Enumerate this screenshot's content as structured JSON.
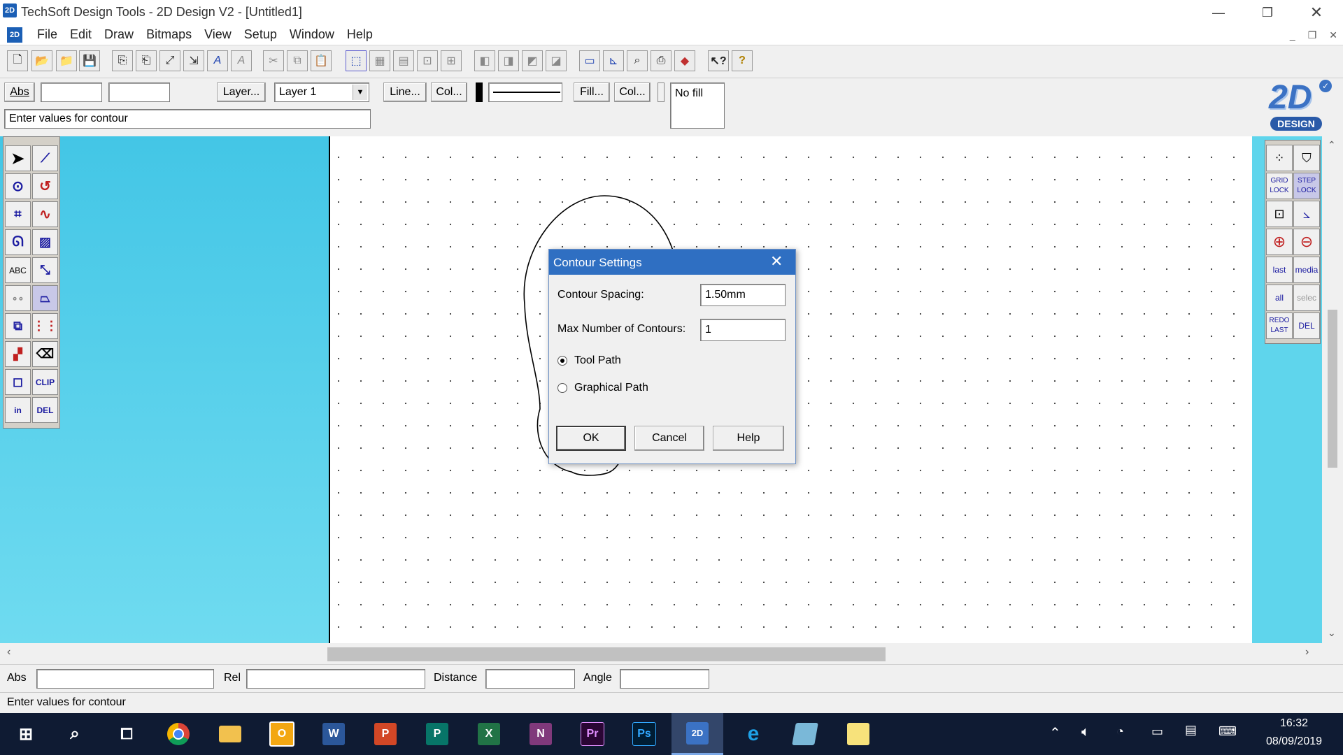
{
  "window": {
    "title": "TechSoft Design Tools - 2D Design V2 - [Untitled1]",
    "app_icon": "2D",
    "controls": {
      "minimize": "—",
      "restore": "❐",
      "close": "✕"
    },
    "mdi_controls": {
      "minimize": "_",
      "restore": "❐",
      "close": "✕"
    }
  },
  "menu": [
    "File",
    "Edit",
    "Draw",
    "Bitmaps",
    "View",
    "Setup",
    "Window",
    "Help"
  ],
  "toolbar_icons": [
    "new-icon",
    "open-icon",
    "open-folder-icon",
    "save-icon",
    "import-icon",
    "export-icon",
    "scale-icon",
    "stretch-icon",
    "text-icon",
    "text-style-icon",
    "cut-icon",
    "copy-icon",
    "paste-icon",
    "select-icon",
    "group-icon",
    "ungroup-icon",
    "align-icon",
    "distribute-icon",
    "layer-up-icon",
    "layer-down-icon",
    "front-icon",
    "back-icon",
    "frame-icon",
    "measure-icon",
    "zoom-tool-icon",
    "print-icon",
    "3d-icon",
    "context-help-icon",
    "help-icon"
  ],
  "propbar": {
    "abs_button": "Abs",
    "layer_button": "Layer...",
    "layer_value": "Layer 1",
    "line_button": "Line...",
    "line_col_button": "Col...",
    "fill_button": "Fill...",
    "fill_col_button": "Col...",
    "fill_value": "No fill",
    "prompt": "Enter values for contour"
  },
  "logo": {
    "text": "2D",
    "subtitle": "DESIGN"
  },
  "left_tools": [
    "ABC",
    "CLIP",
    "in",
    "DEL"
  ],
  "right_tools": {
    "grid_lock": "GRID LOCK",
    "step_lock": "STEP LOCK",
    "last": "last",
    "media": "media",
    "all": "all",
    "select": "selec",
    "redo_last": "REDO LAST",
    "del": "DEL"
  },
  "dialog": {
    "title": "Contour Settings",
    "spacing_label": "Contour Spacing:",
    "spacing_value": "1.50mm",
    "max_label": "Max Number of Contours:",
    "max_value": "1",
    "radio_tool_path": "Tool Path",
    "radio_graphical_path": "Graphical Path",
    "selected": "Tool Path",
    "ok": "OK",
    "cancel": "Cancel",
    "help": "Help"
  },
  "status": {
    "abs_label": "Abs",
    "rel_label": "Rel",
    "distance_label": "Distance",
    "angle_label": "Angle",
    "message": "Enter values for contour"
  },
  "taskbar": {
    "apps": [
      "start-icon",
      "search-icon",
      "task-view-icon",
      "chrome-icon",
      "file-explorer-icon",
      "outlook-icon",
      "word-icon",
      "powerpoint-icon",
      "publisher-icon",
      "excel-icon",
      "onenote-icon",
      "premiere-icon",
      "photoshop-icon",
      "2d-design-icon",
      "internet-explorer-icon",
      "app-icon",
      "sticky-notes-icon"
    ],
    "time": "16:32",
    "date": "08/09/2019"
  }
}
